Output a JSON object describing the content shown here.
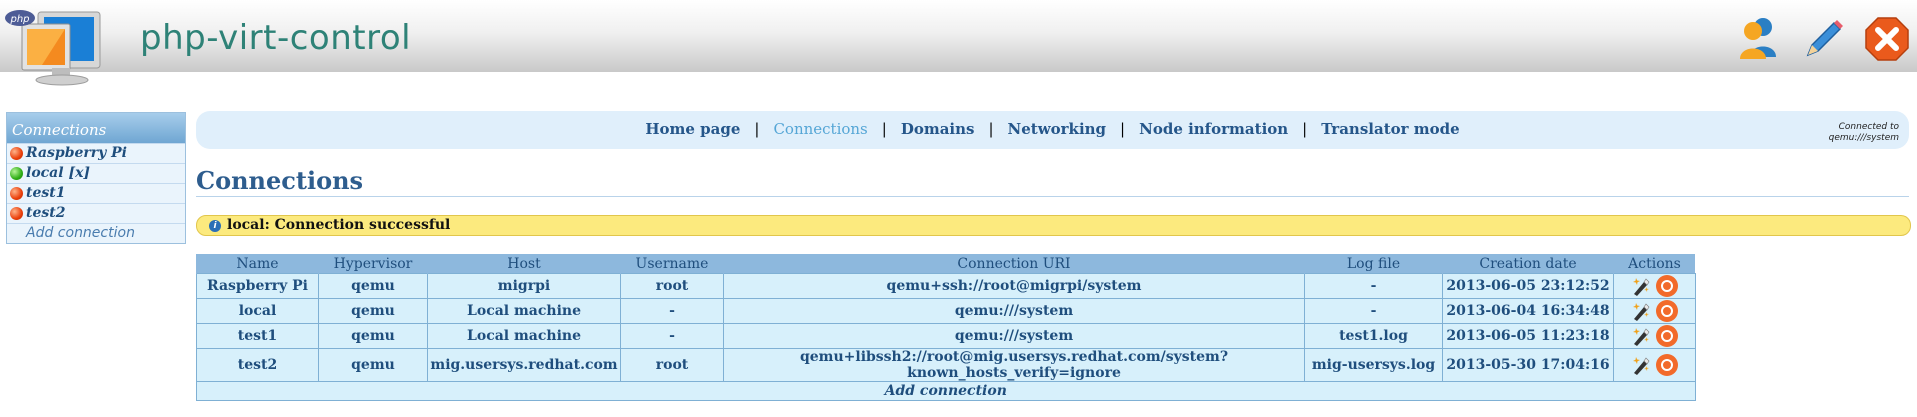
{
  "app": {
    "title": "php-virt-control",
    "logo_badge": "php"
  },
  "header_icons": [
    "users-icon",
    "pencil-icon",
    "close-icon"
  ],
  "sidebar": {
    "title": "Connections",
    "items": [
      {
        "label": "Raspberry Pi",
        "status": "disconnected"
      },
      {
        "label": "local [x]",
        "status": "connected"
      },
      {
        "label": "test1",
        "status": "disconnected"
      },
      {
        "label": "test2",
        "status": "disconnected"
      }
    ],
    "add_label": "Add connection"
  },
  "nav": {
    "items": [
      {
        "label": "Home page",
        "active": false
      },
      {
        "label": "Connections",
        "active": true
      },
      {
        "label": "Domains",
        "active": false
      },
      {
        "label": "Networking",
        "active": false
      },
      {
        "label": "Node information",
        "active": false
      },
      {
        "label": "Translator mode",
        "active": false
      }
    ],
    "separator": "|",
    "status_line1": "Connected to",
    "status_line2": "qemu:///system"
  },
  "page": {
    "title": "Connections",
    "message": "local: Connection successful",
    "message_icon": "info-icon"
  },
  "table": {
    "headers": [
      "Name",
      "Hypervisor",
      "Host",
      "Username",
      "Connection URI",
      "Log file",
      "Creation date",
      "Actions"
    ],
    "rows": [
      [
        "Raspberry Pi",
        "qemu",
        "migrpi",
        "root",
        "qemu+ssh://root@migrpi/system",
        "-",
        "2013-06-05 23:12:52"
      ],
      [
        "local",
        "qemu",
        "Local machine",
        "-",
        "qemu:///system",
        "-",
        "2013-06-04 16:34:48"
      ],
      [
        "test1",
        "qemu",
        "Local machine",
        "-",
        "qemu:///system",
        "test1.log",
        "2013-06-05 11:23:18"
      ],
      [
        "test2",
        "qemu",
        "mig.usersys.redhat.com",
        "root",
        "qemu+libssh2://root@mig.usersys.redhat.com/system?known_hosts_verify=ignore",
        "mig-usersys.log",
        "2013-05-30 17:04:16"
      ]
    ],
    "action_icons": [
      "edit-icon",
      "delete-icon"
    ],
    "add_label": "Add connection"
  },
  "colors": {
    "accent": "#2e8277",
    "nav_text": "#25568a",
    "table_header": "#8db8dd",
    "table_cell": "#d7f0fb",
    "message_bg": "#fcea7e"
  }
}
